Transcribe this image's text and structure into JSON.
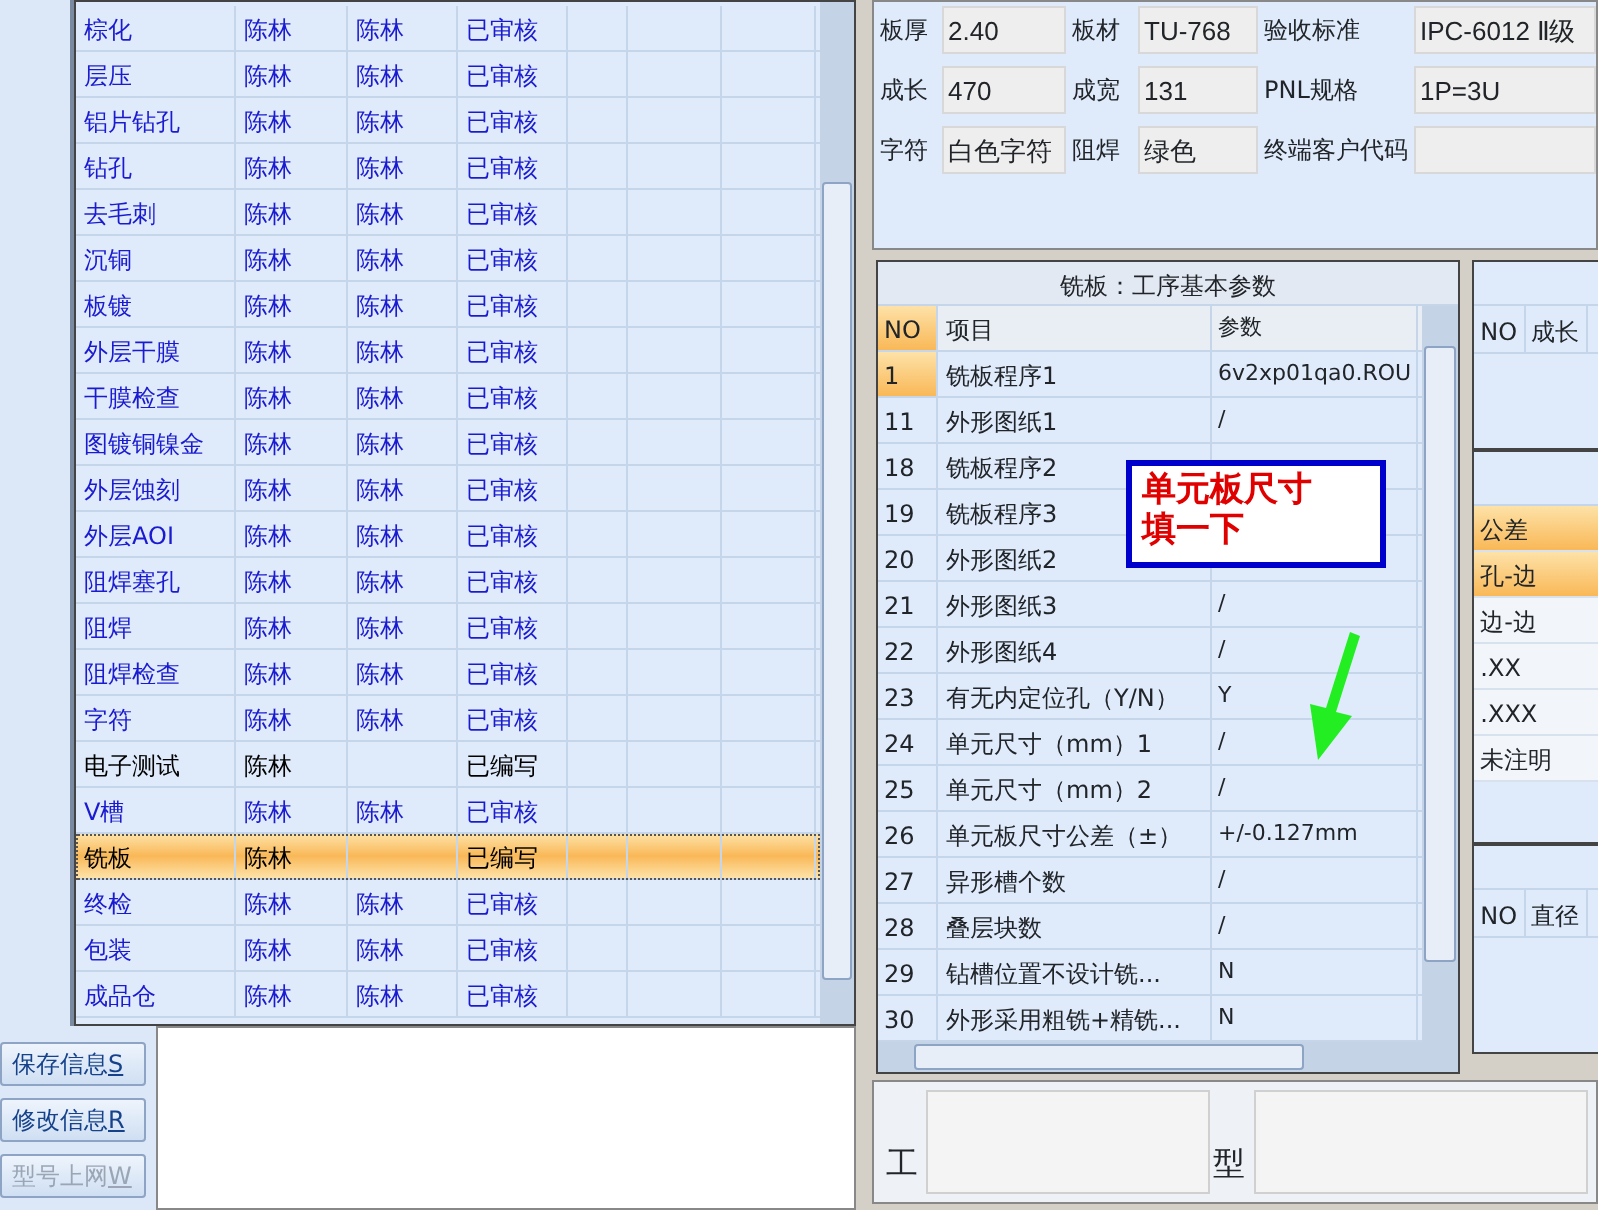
{
  "process_table": {
    "rows": [
      {
        "process": "棕化",
        "column_2": "陈林",
        "column_3": "陈林",
        "status": "已审核",
        "reviewed": true,
        "selected": false
      },
      {
        "process": "层压",
        "column_2": "陈林",
        "column_3": "陈林",
        "status": "已审核",
        "reviewed": true,
        "selected": false
      },
      {
        "process": "铝片钻孔",
        "column_2": "陈林",
        "column_3": "陈林",
        "status": "已审核",
        "reviewed": true,
        "selected": false
      },
      {
        "process": "钻孔",
        "column_2": "陈林",
        "column_3": "陈林",
        "status": "已审核",
        "reviewed": true,
        "selected": false
      },
      {
        "process": "去毛刺",
        "column_2": "陈林",
        "column_3": "陈林",
        "status": "已审核",
        "reviewed": true,
        "selected": false
      },
      {
        "process": "沉铜",
        "column_2": "陈林",
        "column_3": "陈林",
        "status": "已审核",
        "reviewed": true,
        "selected": false
      },
      {
        "process": "板镀",
        "column_2": "陈林",
        "column_3": "陈林",
        "status": "已审核",
        "reviewed": true,
        "selected": false
      },
      {
        "process": "外层干膜",
        "column_2": "陈林",
        "column_3": "陈林",
        "status": "已审核",
        "reviewed": true,
        "selected": false
      },
      {
        "process": "干膜检查",
        "column_2": "陈林",
        "column_3": "陈林",
        "status": "已审核",
        "reviewed": true,
        "selected": false
      },
      {
        "process": "图镀铜镍金",
        "column_2": "陈林",
        "column_3": "陈林",
        "status": "已审核",
        "reviewed": true,
        "selected": false
      },
      {
        "process": "外层蚀刻",
        "column_2": "陈林",
        "column_3": "陈林",
        "status": "已审核",
        "reviewed": true,
        "selected": false
      },
      {
        "process": "外层AOI",
        "column_2": "陈林",
        "column_3": "陈林",
        "status": "已审核",
        "reviewed": true,
        "selected": false
      },
      {
        "process": "阻焊塞孔",
        "column_2": "陈林",
        "column_3": "陈林",
        "status": "已审核",
        "reviewed": true,
        "selected": false
      },
      {
        "process": "阻焊",
        "column_2": "陈林",
        "column_3": "陈林",
        "status": "已审核",
        "reviewed": true,
        "selected": false
      },
      {
        "process": "阻焊检查",
        "column_2": "陈林",
        "column_3": "陈林",
        "status": "已审核",
        "reviewed": true,
        "selected": false
      },
      {
        "process": "字符",
        "column_2": "陈林",
        "column_3": "陈林",
        "status": "已审核",
        "reviewed": true,
        "selected": false
      },
      {
        "process": "电子测试",
        "column_2": "陈林",
        "status": "已编写",
        "reviewed": false,
        "selected": false
      },
      {
        "process": "V槽",
        "column_2": "陈林",
        "column_3": "陈林",
        "status": "已审核",
        "reviewed": true,
        "selected": false
      },
      {
        "process": "铣板",
        "column_2": "陈林",
        "status": "已编写",
        "reviewed": false,
        "selected": true
      },
      {
        "process": "终检",
        "column_2": "陈林",
        "column_3": "陈林",
        "status": "已审核",
        "reviewed": true,
        "selected": false
      },
      {
        "process": "包装",
        "column_2": "陈林",
        "column_3": "陈林",
        "status": "已审核",
        "reviewed": true,
        "selected": false
      },
      {
        "process": "成品仓",
        "column_2": "陈林",
        "column_3": "陈林",
        "status": "已审核",
        "reviewed": true,
        "selected": false
      }
    ]
  },
  "buttons": [
    {
      "label": "保存信息",
      "shortcut": "S",
      "disabled": false
    },
    {
      "label": "修改信息",
      "shortcut": "R",
      "disabled": false
    },
    {
      "label": "型号上网",
      "shortcut": "W",
      "disabled": true
    }
  ],
  "board_info": [
    {
      "label": "板厚",
      "value": "2.40"
    },
    {
      "label": "板材",
      "value": "TU-768"
    },
    {
      "label": "验收标准",
      "value": "IPC-6012 Ⅱ级"
    },
    {
      "label": "成长",
      "value": "470"
    },
    {
      "label": "成宽",
      "value": "131"
    },
    {
      "label": "PNL规格",
      "value": "1P=3U"
    },
    {
      "label": "字符",
      "value": "白色字符"
    },
    {
      "label": "阻焊",
      "value": "绿色"
    },
    {
      "label": "终端客户代码"
    }
  ],
  "params_table": {
    "title": "铣板：工序基本参数",
    "columns": [
      "NO",
      "项目",
      "参数"
    ],
    "rows": [
      {
        "no": "1",
        "item": "铣板程序1",
        "value": "6v2xp01qa0.ROU",
        "selected": true
      },
      {
        "no": "11",
        "item": "外形图纸1",
        "value": "/",
        "selected": false
      },
      {
        "no": "18",
        "item": "铣板程序2",
        "selected": false
      },
      {
        "no": "19",
        "item": "铣板程序3",
        "selected": false
      },
      {
        "no": "20",
        "item": "外形图纸2",
        "selected": false
      },
      {
        "no": "21",
        "item": "外形图纸3",
        "value": "/",
        "selected": false
      },
      {
        "no": "22",
        "item": "外形图纸4",
        "value": "/",
        "selected": false
      },
      {
        "no": "23",
        "item": "有无内定位孔（Y/N）",
        "value": "Y",
        "selected": false
      },
      {
        "no": "24",
        "item": "单元尺寸（mm）1",
        "value": "/",
        "selected": false
      },
      {
        "no": "25",
        "item": "单元尺寸（mm）2",
        "value": "/",
        "selected": false
      },
      {
        "no": "26",
        "item": "单元板尺寸公差（±）",
        "value": "+/-0.127mm",
        "selected": false
      },
      {
        "no": "27",
        "item": "异形槽个数",
        "value": "/",
        "selected": false
      },
      {
        "no": "28",
        "item": "叠层块数",
        "value": "/",
        "selected": false
      },
      {
        "no": "29",
        "item": "钻槽位置不设计铣...",
        "value": "N",
        "selected": false
      },
      {
        "no": "30",
        "item": "外形采用粗铣+精铣...",
        "value": "N",
        "selected": false
      }
    ]
  },
  "annotation": {
    "lines": [
      "单元板尺寸",
      "填一下"
    ]
  },
  "size_panel": {
    "columns": [
      "NO",
      "成长"
    ]
  },
  "tolerance_panel": {
    "header": "公差",
    "rows": [
      {
        "label": "孔-边",
        "selected": true
      },
      {
        "label": "边-边",
        "selected": false
      },
      {
        "label": ".XX",
        "selected": false
      },
      {
        "label": ".XXX",
        "selected": false
      },
      {
        "label": "未注明",
        "selected": false
      }
    ]
  },
  "diameter_panel": {
    "columns": [
      "NO",
      "直径"
    ]
  },
  "memo_fields": [
    {
      "label": "工"
    },
    {
      "label": "型"
    }
  ]
}
